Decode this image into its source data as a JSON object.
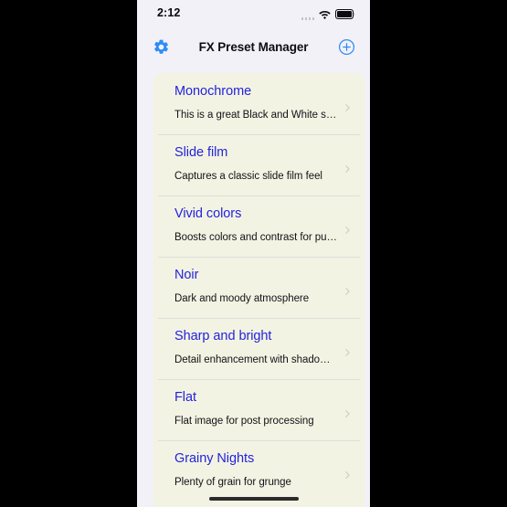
{
  "device": {
    "status_bar": {
      "time": "2:12",
      "signal_icon": "signal-bars-icon",
      "wifi_icon": "wifi-icon",
      "battery_icon": "battery-icon"
    },
    "home_indicator": "home-indicator"
  },
  "nav": {
    "title": "FX Preset Manager",
    "left_button": {
      "name": "settings-button",
      "icon": "gear-icon"
    },
    "right_button": {
      "name": "add-preset-button",
      "icon": "plus-circle-icon"
    }
  },
  "colors": {
    "accent_blue": "#2323dd",
    "icon_blue": "#2f8bf5",
    "list_background": "#f3f3e3",
    "screen_background": "#f2f1f7",
    "separator": "#dededc",
    "chevron": "#c9c9c0",
    "subtitle_text": "#121218",
    "frame": "#000000"
  },
  "presets": [
    {
      "title": "Monochrome",
      "subtitle": "This is a great Black and White setting",
      "chevron": "chevron-right-icon"
    },
    {
      "title": "Slide film",
      "subtitle": "Captures a classic slide film feel",
      "chevron": "chevron-right-icon"
    },
    {
      "title": "Vivid colors",
      "subtitle": "Boosts colors and contrast for punch",
      "chevron": "chevron-right-icon"
    },
    {
      "title": "Noir",
      "subtitle": "Dark and moody atmosphere",
      "chevron": "chevron-right-icon"
    },
    {
      "title": "Sharp and bright",
      "subtitle": "Detail enhancement with shadow bo...",
      "chevron": "chevron-right-icon"
    },
    {
      "title": "Flat",
      "subtitle": "Flat image for post processing",
      "chevron": "chevron-right-icon"
    },
    {
      "title": "Grainy Nights",
      "subtitle": "Plenty of grain for grunge",
      "chevron": "chevron-right-icon"
    }
  ]
}
